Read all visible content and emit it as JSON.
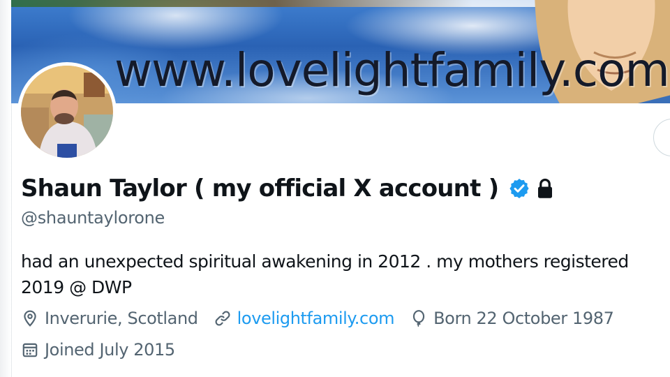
{
  "banner": {
    "url_text": "www.lovelightfamily.com"
  },
  "profile": {
    "avatar_icon": "profile-photo",
    "display_name": "Shaun Taylor ( my official X account )",
    "verified_icon": "verified-badge-icon",
    "protected_icon": "lock-icon",
    "handle": "@shauntaylorone",
    "bio": "had an unexpected spiritual awakening in 2012 . my mothers registered\n2019 @ DWP"
  },
  "meta": {
    "location": "Inverurie, Scotland",
    "website": "lovelightfamily.com",
    "birthday": "Born 22 October 1987",
    "joined": "Joined July 2015"
  },
  "colors": {
    "accent": "#1d9bf0",
    "secondary_text": "#536471",
    "primary_text": "#0f1419"
  }
}
